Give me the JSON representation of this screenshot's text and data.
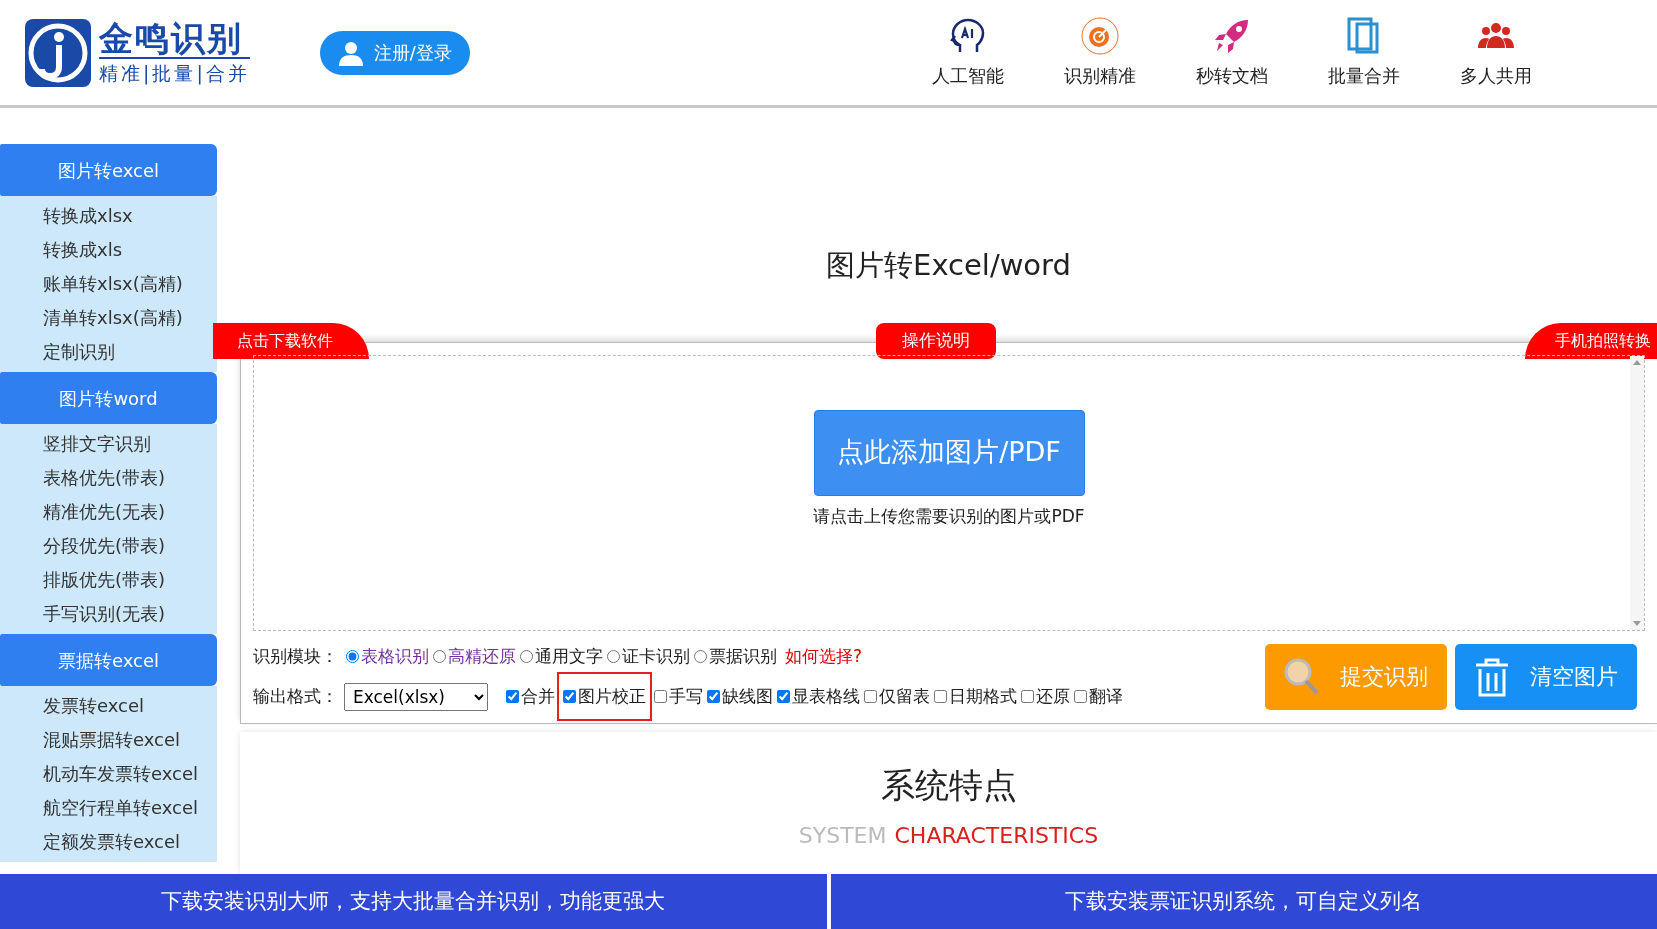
{
  "header": {
    "logo": {
      "title": "金鸣识别",
      "tagline": "精准|批量|合并"
    },
    "login_button": "注册/登录",
    "features": [
      {
        "label": "人工智能",
        "kind": "ai"
      },
      {
        "label": "识别精准",
        "kind": "target"
      },
      {
        "label": "秒转文档",
        "kind": "rocket"
      },
      {
        "label": "批量合并",
        "kind": "pages"
      },
      {
        "label": "多人共用",
        "kind": "people"
      }
    ]
  },
  "sidebar": {
    "groups": [
      {
        "title": "图片转excel",
        "items": [
          "转换成xlsx",
          "转换成xls",
          "账单转xlsx(高精)",
          "清单转xlsx(高精)",
          "定制识别"
        ]
      },
      {
        "title": "图片转word",
        "items": [
          "竖排文字识别",
          "表格优先(带表)",
          "精准优先(无表)",
          "分段优先(带表)",
          "排版优先(带表)",
          "手写识别(无表)"
        ]
      },
      {
        "title": "票据转excel",
        "items": [
          "发票转excel",
          "混贴票据转excel",
          "机动车发票转excel",
          "航空行程单转excel",
          "定额发票转excel"
        ]
      }
    ]
  },
  "main": {
    "title": "图片转Excel/word",
    "ribbons": [
      {
        "label": "点击下载软件",
        "kind": "left"
      },
      {
        "label": "操作说明",
        "kind": "center"
      },
      {
        "label": "手机拍照转换",
        "kind": "right"
      }
    ],
    "upload": {
      "button": "点此添加图片/PDF",
      "hint": "请点击上传您需要识别的图片或PDF"
    },
    "module": {
      "label": "识别模块：",
      "options": [
        {
          "label": "表格识别",
          "selected": true,
          "color": "#7030a0"
        },
        {
          "label": "高精还原",
          "selected": false,
          "color": "#7030a0"
        },
        {
          "label": "通用文字",
          "selected": false,
          "color": "#222222"
        },
        {
          "label": "证卡识别",
          "selected": false,
          "color": "#222222"
        },
        {
          "label": "票据识别",
          "selected": false,
          "color": "#222222"
        }
      ],
      "help_link": "如何选择?"
    },
    "output": {
      "label": "输出格式：",
      "format": "Excel(xlsx)",
      "options": [
        {
          "label": "合并",
          "checked": true,
          "highlighted": false
        },
        {
          "label": "图片校正",
          "checked": true,
          "highlighted": true
        },
        {
          "label": "手写",
          "checked": false,
          "highlighted": false
        },
        {
          "label": "缺线图",
          "checked": true,
          "highlighted": false
        },
        {
          "label": "显表格线",
          "checked": true,
          "highlighted": false
        },
        {
          "label": "仅留表",
          "checked": false,
          "highlighted": false
        },
        {
          "label": "日期格式",
          "checked": false,
          "highlighted": false
        },
        {
          "label": "还原",
          "checked": false,
          "highlighted": false
        },
        {
          "label": "翻译",
          "checked": false,
          "highlighted": false
        }
      ]
    },
    "actions": [
      {
        "label": "提交识别",
        "kind": "submit"
      },
      {
        "label": "清空图片",
        "kind": "clear"
      }
    ],
    "features_section": {
      "title": "系统特点",
      "subtitle_gray": "SYSTEM",
      "subtitle_red": "CHARACTERISTICS"
    }
  },
  "footer": [
    "下载安装识别大师，支持大批量合并识别，功能更强大",
    "下载安装票证识别系统，可自定义列名"
  ]
}
